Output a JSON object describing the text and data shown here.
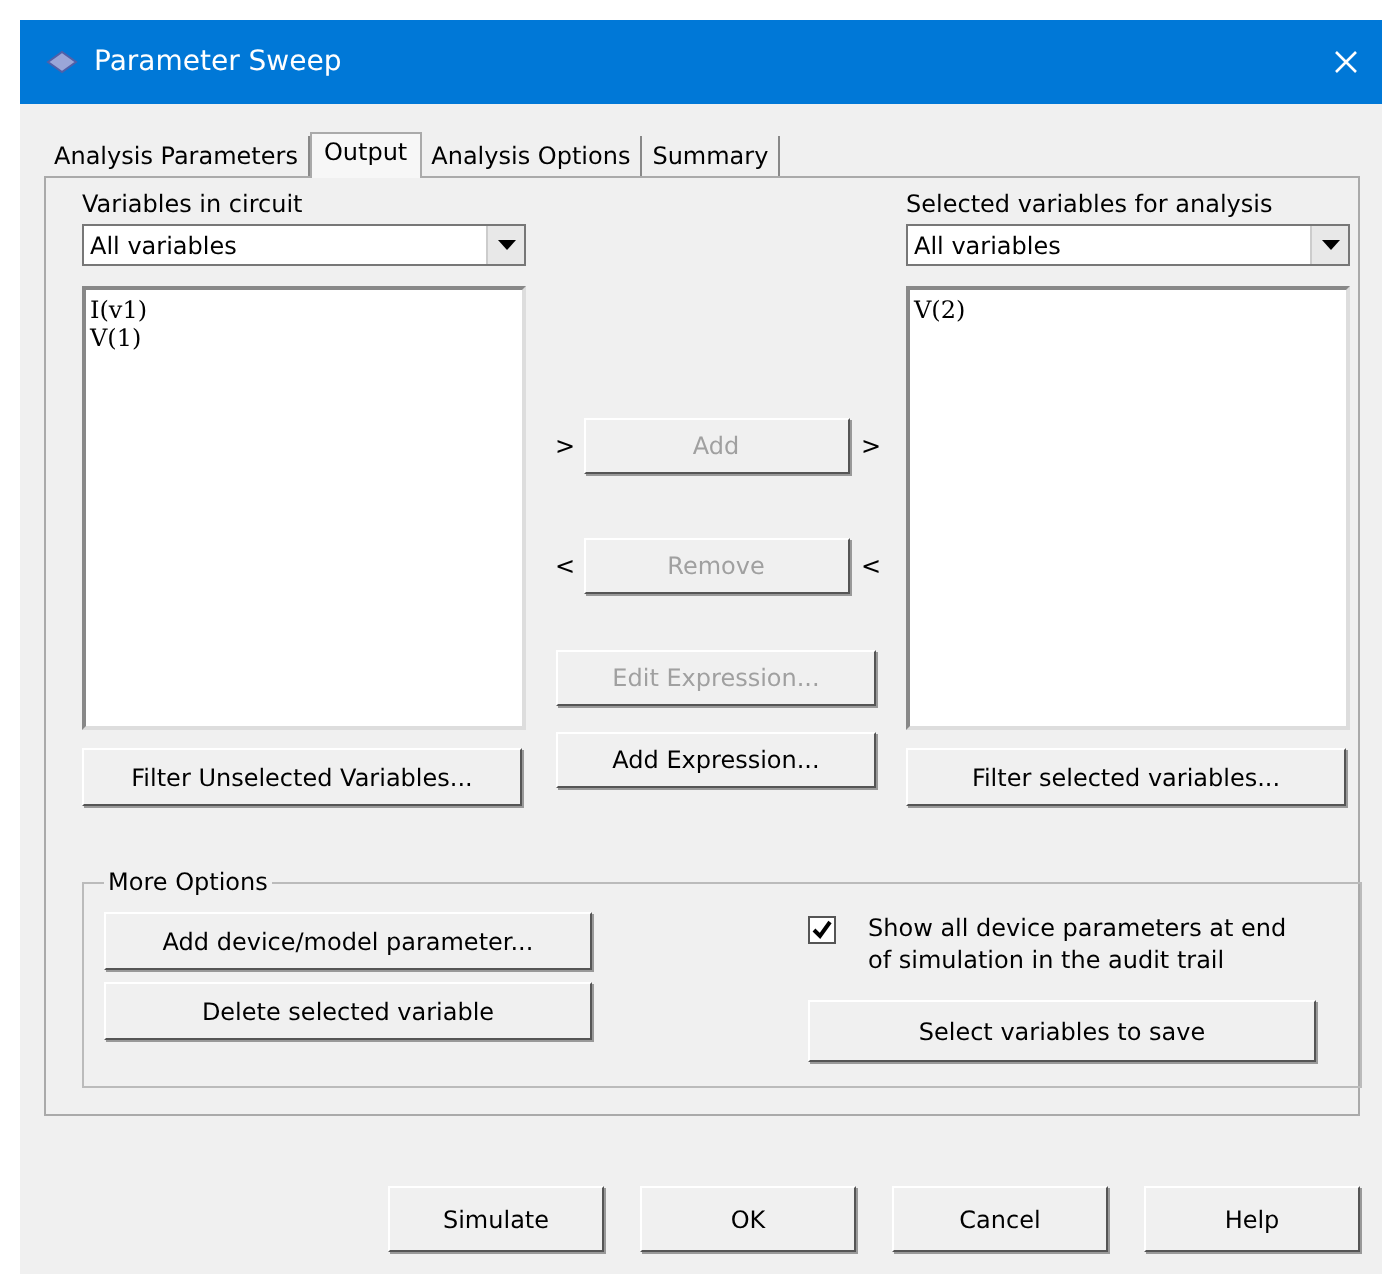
{
  "window": {
    "title": "Parameter Sweep"
  },
  "tabs": [
    {
      "label": "Analysis Parameters",
      "selected": false
    },
    {
      "label": "Output",
      "selected": true
    },
    {
      "label": "Analysis Options",
      "selected": false
    },
    {
      "label": "Summary",
      "selected": false
    }
  ],
  "left": {
    "label": "Variables in circuit",
    "dropdown": "All variables",
    "items": [
      "I(v1)",
      "V(1)"
    ],
    "filter_button": "Filter Unselected Variables..."
  },
  "middle": {
    "add_marks": [
      ">",
      ">"
    ],
    "add_button": {
      "label": "Add",
      "disabled": true
    },
    "remove_marks": [
      "<",
      "<"
    ],
    "remove_button": {
      "label": "Remove",
      "disabled": true
    },
    "edit_button": {
      "label": "Edit Expression...",
      "disabled": true
    },
    "add_expression_button": {
      "label": "Add Expression...",
      "disabled": false
    }
  },
  "right": {
    "label": "Selected variables for analysis",
    "dropdown": "All variables",
    "items": [
      "V(2)"
    ],
    "filter_button": "Filter selected variables..."
  },
  "more_options": {
    "title": "More Options",
    "add_param_button": "Add device/model parameter...",
    "delete_button": "Delete selected variable",
    "show_params": {
      "label": "Show all device parameters at end of simulation in the audit trail",
      "checked": true
    },
    "save_button": "Select variables to save"
  },
  "buttons": [
    "Simulate",
    "OK",
    "Cancel",
    "Help"
  ]
}
